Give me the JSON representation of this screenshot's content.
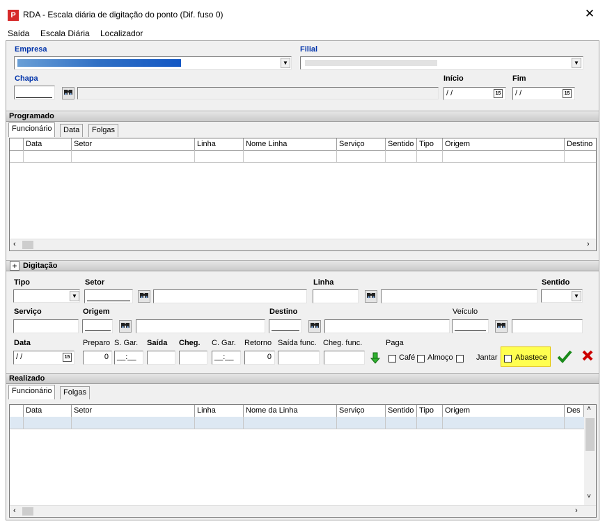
{
  "window": {
    "title": "RDA - Escala diária de digitação do ponto (Dif. fuso 0)",
    "icon_label": "P",
    "close_glyph": "✕"
  },
  "menu": [
    "Saída",
    "Escala Diária",
    "Localizador"
  ],
  "header": {
    "empresa_label": "Empresa",
    "filial_label": "Filial",
    "chapa_label": "Chapa",
    "chapa_value": "",
    "chapa_name_value": "",
    "inicio_label": "Início",
    "inicio_value": "/ /",
    "fim_label": "Fim",
    "fim_value": "/ /"
  },
  "programado": {
    "title": "Programado",
    "tabs": [
      "Funcionário",
      "Data",
      "Folgas"
    ],
    "columns": [
      "Data",
      "Setor",
      "Linha",
      "Nome Linha",
      "Serviço",
      "Sentido",
      "Tipo",
      "Origem",
      "Destino"
    ]
  },
  "digitacao": {
    "title": "Digitação",
    "expand_glyph": "+",
    "tipo_label": "Tipo",
    "setor_label": "Setor",
    "linha_label": "Linha",
    "sentido_label": "Sentido",
    "servico_label": "Serviço",
    "origem_label": "Origem",
    "destino_label": "Destino",
    "veiculo_label": "Veículo",
    "data_label": "Data",
    "data_value": "/ /",
    "preparo_label": "Preparo",
    "preparo_value": "0",
    "sgar_label": "S. Gar.",
    "sgar_value": "__:__",
    "saida_label": "Saída",
    "cheg_label": "Cheg.",
    "cgar_label": "C. Gar.",
    "cgar_value": "__:__",
    "retorno_label": "Retorno",
    "retorno_value": "0",
    "saida_func_label": "Saída func.",
    "cheg_func_label": "Cheg. func.",
    "paga_label": "Paga",
    "cafe_label": "Café",
    "almoco_label": "Almoço",
    "jantar_label": "Jantar",
    "abastece_label": "Abastece"
  },
  "realizado": {
    "title": "Realizado",
    "tabs": [
      "Funcionário",
      "Folgas"
    ],
    "columns": [
      "Data",
      "Setor",
      "Linha",
      "Nome da Linha",
      "Serviço",
      "Sentido",
      "Tipo",
      "Origem",
      "Des"
    ]
  },
  "icons": {
    "binoculars": "binoculars-icon",
    "calendar": "calendar-icon",
    "down_arrow": "green-down-arrow-icon",
    "confirm": "green-check-icon",
    "cancel": "red-x-icon"
  },
  "colors": {
    "highlight": "#ffff50",
    "confirm": "#1a8a1a",
    "cancel": "#cc0000",
    "app_icon": "#d62a2a"
  }
}
